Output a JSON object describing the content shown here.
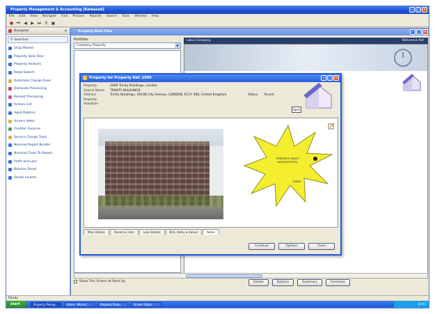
{
  "app": {
    "title": "Property Management & Accounting [Released]",
    "menu": [
      "File",
      "Edit",
      "View",
      "Navigate",
      "Find",
      "Process",
      "Reports",
      "Search",
      "Tools",
      "Window",
      "Help"
    ]
  },
  "sidebar": {
    "header": "Navigator",
    "search_label": "Searches",
    "items": [
      {
        "label": "Shop Market",
        "color": "#3c6fd1"
      },
      {
        "label": "Property Data Files",
        "color": "#3c6fd1"
      },
      {
        "label": "Property Analysis",
        "color": "#3c6fd1"
      },
      {
        "label": "Retail Search",
        "color": "#3c6fd1"
      },
      {
        "label": "Automate Charge Rules",
        "color": "#e2b52b"
      },
      {
        "label": "Demands Processing",
        "color": "#c94646"
      },
      {
        "label": "Receipt Processing",
        "color": "#c24fb8"
      },
      {
        "label": "Arrears List",
        "color": "#3c6fd1"
      },
      {
        "label": "Aged Debtors",
        "color": "#3c6fd1"
      },
      {
        "label": "Arrears letter",
        "color": "#e2b52b"
      },
      {
        "label": "Creditor Invoices",
        "color": "#4da34d"
      },
      {
        "label": "Service Charge Track",
        "color": "#e2b52b"
      },
      {
        "label": "Nominal Report Builder",
        "color": "#3c6fd1"
      },
      {
        "label": "Nominal Chart To Report",
        "color": "#3c6fd1"
      },
      {
        "label": "Profit and Loss",
        "color": "#3c6fd1"
      },
      {
        "label": "Balance Sheet",
        "color": "#3c6fd1"
      },
      {
        "label": "Rental Income",
        "color": "#3c6fd1"
      }
    ]
  },
  "main_window": {
    "title": "Property Data Files",
    "filter_label": "Portfolio",
    "filter_value": "Company Property",
    "grid_header_left": "Lotus Company",
    "grid_header_right": "Reference Ref",
    "show_checkbox_label": "Show This Screen At Start Up",
    "buttons": [
      "Delete",
      "Options",
      "Summary",
      "Formulae"
    ]
  },
  "dialog": {
    "title": "Property for Property Ref: 2000",
    "fields": [
      {
        "label": "Property",
        "value": "2000        Trinity Buildings, London"
      },
      {
        "label": "Search Name",
        "value": "TRINITY BUILDINGS"
      },
      {
        "label": "Address",
        "value": "Trinity Buildings, 40108 City Avenue, LONDON, EC1Y 4BS, United Kingdom"
      },
      {
        "label": "Property",
        "value": ""
      },
      {
        "label": "Valuation",
        "value": ""
      }
    ],
    "status_label": "Status",
    "status_value": "Tenant",
    "open_button": "Open",
    "star_text": "Indicative report area/summary",
    "star_footer": "Lease",
    "tabs": [
      "Main Details",
      "Tenant & Units",
      "Loan Details",
      "Bills, Rates & Values",
      "Notes"
    ],
    "buttons": [
      "Continue",
      "Options",
      "Close"
    ]
  },
  "taskbar": {
    "start": "start",
    "tasks": [
      "Property Manag...",
      "Inbox - Micros...",
      "Property Data...",
      "Screen Shots"
    ],
    "time": "10:43"
  },
  "statusbar": {
    "text": "Ready"
  }
}
